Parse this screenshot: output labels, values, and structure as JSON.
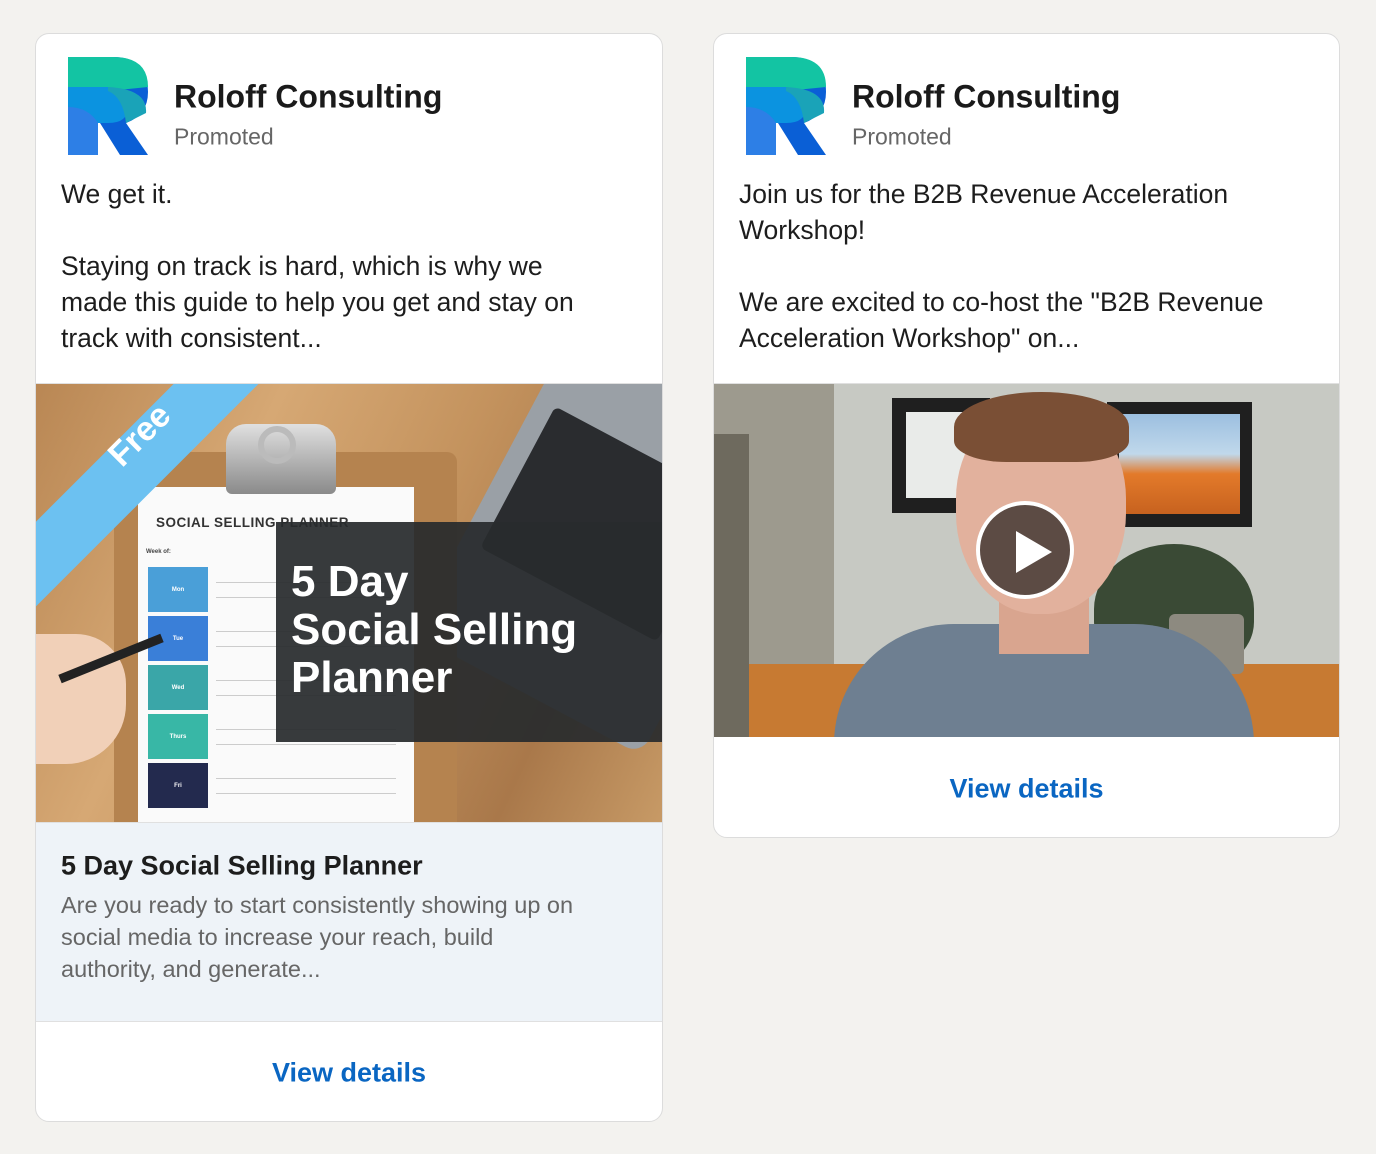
{
  "cards": [
    {
      "company": "Roloff Consulting",
      "promoted": "Promoted",
      "body": [
        "We get it.",
        "",
        "Staying on track is hard, which is why we",
        "made this guide to help you get and stay on",
        "track with consistent..."
      ],
      "image": {
        "ribbon": "Free",
        "paper_title": "SOCIAL SELLING PLANNER",
        "paper_week": "Week of:",
        "days": [
          "Mon",
          "Tue",
          "Wed",
          "Thurs",
          "Fri"
        ],
        "overlay_lines": [
          "5 Day",
          "Social Selling",
          "Planner"
        ]
      },
      "link_title": "5 Day Social Selling Planner",
      "link_desc": [
        "Are you ready to start consistently showing up on",
        "social media to increase your reach, build",
        "authority, and generate..."
      ],
      "cta": "View details"
    },
    {
      "company": "Roloff Consulting",
      "promoted": "Promoted",
      "body": [
        "Join us for the B2B Revenue Acceleration",
        "Workshop!",
        "",
        "We are excited to co-host the \"B2B Revenue",
        "Acceleration Workshop\" on..."
      ],
      "cta": "View details"
    }
  ],
  "colors": {
    "background": "#f3f2ef",
    "link_blue": "#0a66c2",
    "ribbon_blue": "#6cc1f1",
    "day_colors": [
      "#4a9fd8",
      "#3a7fd8",
      "#3aa6a8",
      "#38b7a6",
      "#232a4e"
    ]
  },
  "icons": {
    "logo": "roloff-r-logo",
    "play": "play-icon"
  }
}
